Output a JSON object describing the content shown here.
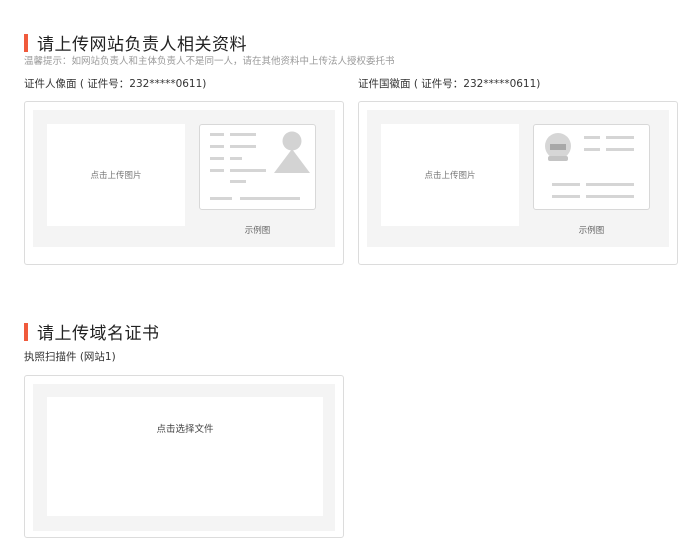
{
  "section1": {
    "title": "请上传网站负责人相关资料",
    "tip": "温馨提示：如网站负责人和主体负责人不是同一人，请在其他资料中上传法人授权委托书",
    "front": {
      "label": "证件人像面 ( 证件号：232*****0611)",
      "upload_text": "点击上传图片",
      "example_caption": "示例图"
    },
    "back": {
      "label": "证件国徽面 ( 证件号：232*****0611)",
      "upload_text": "点击上传图片",
      "example_caption": "示例图"
    }
  },
  "section2": {
    "title": "请上传域名证书",
    "label": "执照扫描件 (网站1)",
    "upload_text": "点击选择文件"
  },
  "colors": {
    "accent": "#f05a3c",
    "panel_bg": "#f4f4f4",
    "border": "#dcdcdc"
  },
  "icons": {
    "front_example": "id-card-portrait-icon",
    "back_example": "id-card-emblem-icon"
  }
}
